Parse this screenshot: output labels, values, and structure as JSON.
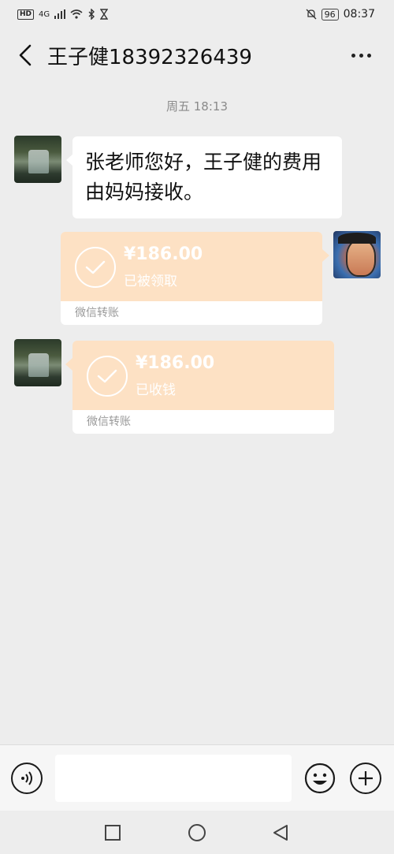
{
  "status_bar": {
    "left_badge": "HD",
    "network": "4G",
    "battery": "96",
    "time": "08:37"
  },
  "header": {
    "title": "王子健18392326439",
    "back_icon": "chevron-left-icon",
    "more_icon": "more-dots-icon"
  },
  "chat": {
    "timestamp": "周五 18:13",
    "messages": [
      {
        "type": "text",
        "side": "left",
        "text": "张老师您好，王子健的费用由妈妈接收。"
      },
      {
        "type": "transfer",
        "side": "right",
        "amount": "¥186.00",
        "status": "已被领取",
        "label": "微信转账"
      },
      {
        "type": "transfer",
        "side": "left",
        "amount": "¥186.00",
        "status": "已收钱",
        "label": "微信转账"
      }
    ]
  },
  "input_bar": {
    "placeholder": "",
    "voice_icon": "voice-icon",
    "emoji_icon": "emoji-icon",
    "plus_icon": "plus-icon"
  },
  "nav_bar": {
    "icons": [
      "recent-apps-icon",
      "home-icon",
      "back-triangle-icon"
    ]
  },
  "colors": {
    "background": "#ededed",
    "transfer_orange": "#fde1c4",
    "bubble_white": "#ffffff"
  }
}
